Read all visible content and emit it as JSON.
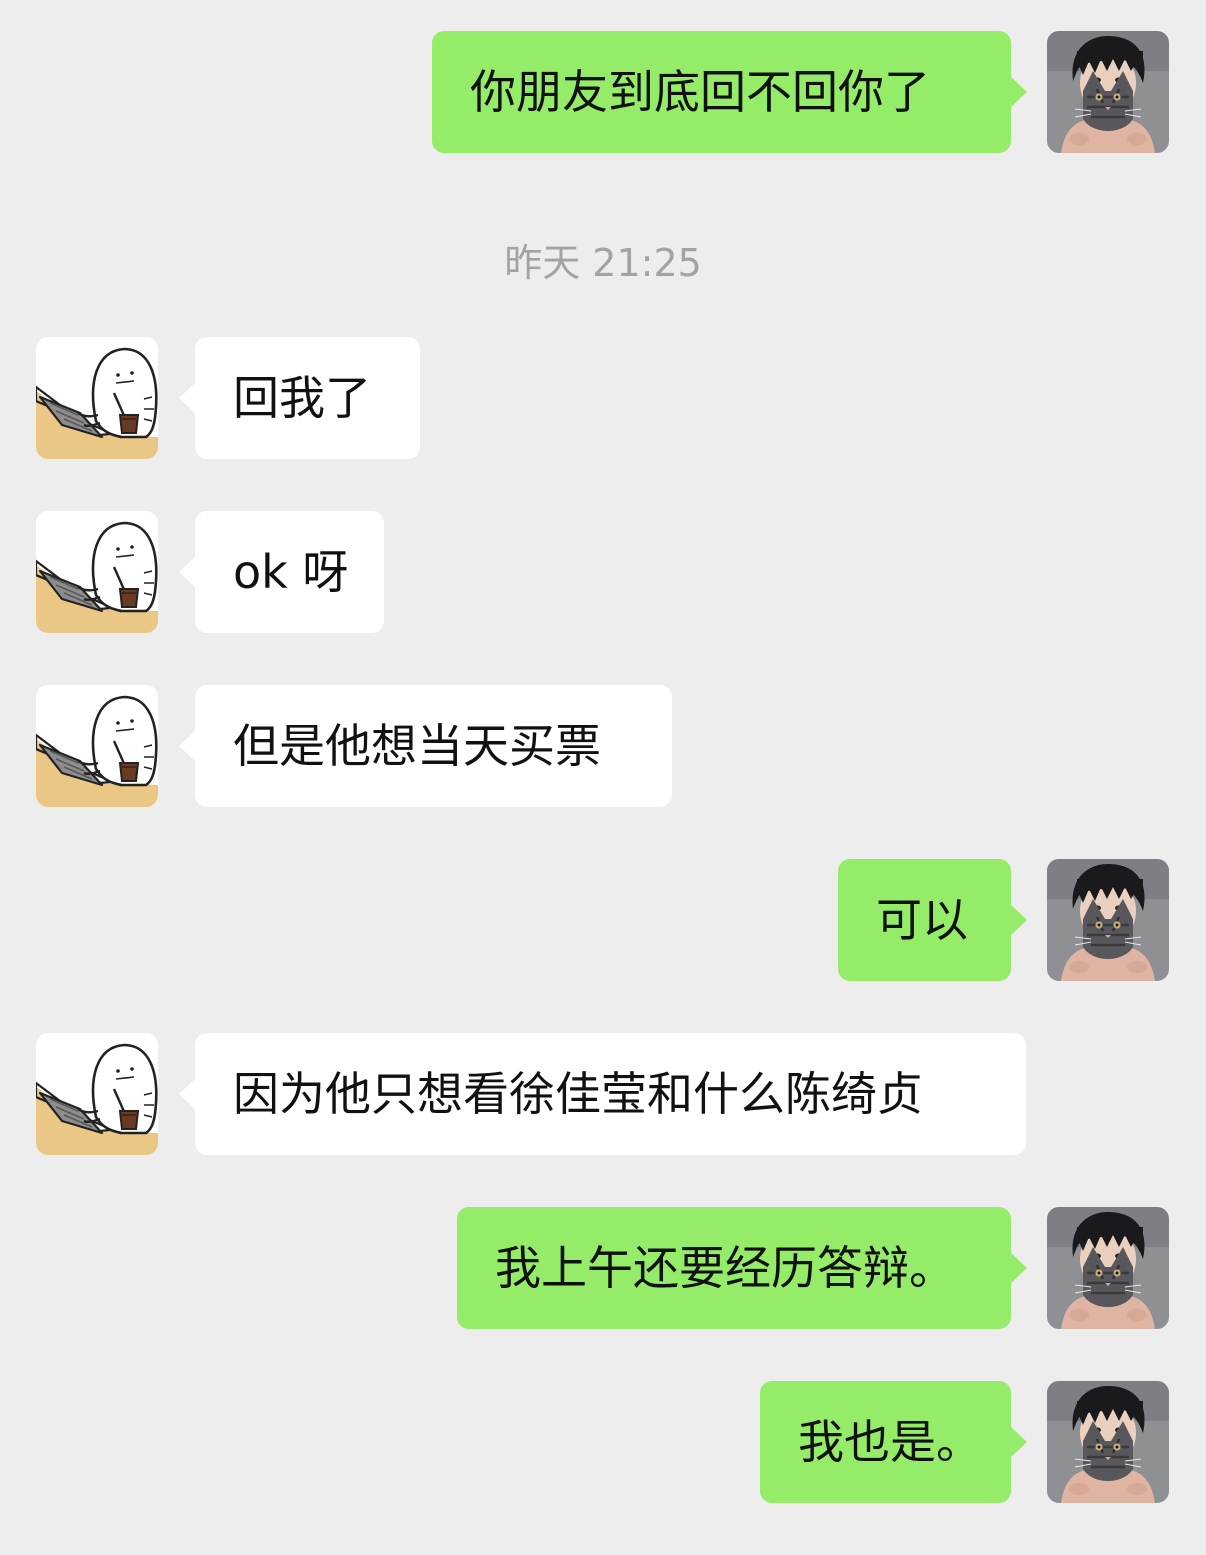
{
  "conversation": {
    "timestamp": "昨天 21:25",
    "messages": [
      {
        "side": "sent",
        "text": "你朋友到底回不回你了"
      },
      {
        "side": "received",
        "text": "回我了"
      },
      {
        "side": "received",
        "text": "ok 呀"
      },
      {
        "side": "received",
        "text": "但是他想当天买票"
      },
      {
        "side": "sent",
        "text": "可以"
      },
      {
        "side": "received",
        "text": "因为他只想看徐佳莹和什么陈绮贞"
      },
      {
        "side": "sent",
        "text": "我上午还要经历答辩。"
      },
      {
        "side": "sent",
        "text": "我也是。"
      }
    ]
  },
  "avatars": {
    "self": "boy-with-cat-avatar-icon",
    "friend": "ghost-laptop-drink-avatar-icon"
  },
  "colors": {
    "background": "#ededed",
    "sent_bubble": "#95ec69",
    "received_bubble": "#ffffff",
    "timestamp_text": "#a3a3a3"
  }
}
